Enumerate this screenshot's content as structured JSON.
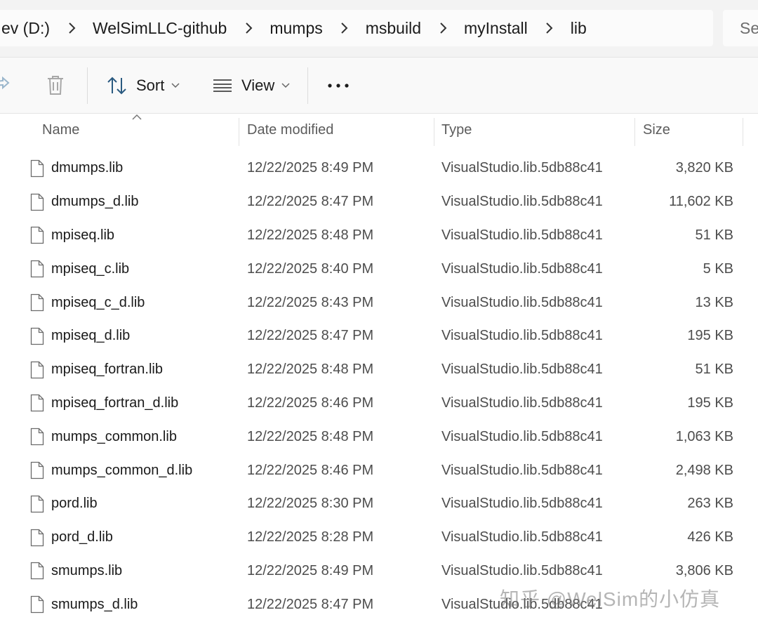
{
  "breadcrumb": {
    "items": [
      "ev (D:)",
      "WelSimLLC-github",
      "mumps",
      "msbuild",
      "myInstall",
      "lib"
    ],
    "separator_icon": "chevron-right-icon"
  },
  "search": {
    "placeholder": "Se"
  },
  "toolbar": {
    "share_icon": "share-icon",
    "delete_icon": "trash-icon",
    "sort_label": "Sort",
    "view_label": "View",
    "more_icon": "more-horizontal-icon"
  },
  "columns": {
    "name": "Name",
    "date_modified": "Date modified",
    "type": "Type",
    "size": "Size"
  },
  "files": [
    {
      "name": "dmumps.lib",
      "date": "12/22/2025 8:49 PM",
      "type": "VisualStudio.lib.5db88c41",
      "size": "3,820 KB"
    },
    {
      "name": "dmumps_d.lib",
      "date": "12/22/2025 8:47 PM",
      "type": "VisualStudio.lib.5db88c41",
      "size": "11,602 KB"
    },
    {
      "name": "mpiseq.lib",
      "date": "12/22/2025 8:48 PM",
      "type": "VisualStudio.lib.5db88c41",
      "size": "51 KB"
    },
    {
      "name": "mpiseq_c.lib",
      "date": "12/22/2025 8:40 PM",
      "type": "VisualStudio.lib.5db88c41",
      "size": "5 KB"
    },
    {
      "name": "mpiseq_c_d.lib",
      "date": "12/22/2025 8:43 PM",
      "type": "VisualStudio.lib.5db88c41",
      "size": "13 KB"
    },
    {
      "name": "mpiseq_d.lib",
      "date": "12/22/2025 8:47 PM",
      "type": "VisualStudio.lib.5db88c41",
      "size": "195 KB"
    },
    {
      "name": "mpiseq_fortran.lib",
      "date": "12/22/2025 8:48 PM",
      "type": "VisualStudio.lib.5db88c41",
      "size": "51 KB"
    },
    {
      "name": "mpiseq_fortran_d.lib",
      "date": "12/22/2025 8:46 PM",
      "type": "VisualStudio.lib.5db88c41",
      "size": "195 KB"
    },
    {
      "name": "mumps_common.lib",
      "date": "12/22/2025 8:48 PM",
      "type": "VisualStudio.lib.5db88c41",
      "size": "1,063 KB"
    },
    {
      "name": "mumps_common_d.lib",
      "date": "12/22/2025 8:46 PM",
      "type": "VisualStudio.lib.5db88c41",
      "size": "2,498 KB"
    },
    {
      "name": "pord.lib",
      "date": "12/22/2025 8:30 PM",
      "type": "VisualStudio.lib.5db88c41",
      "size": "263 KB"
    },
    {
      "name": "pord_d.lib",
      "date": "12/22/2025 8:28 PM",
      "type": "VisualStudio.lib.5db88c41",
      "size": "426 KB"
    },
    {
      "name": "smumps.lib",
      "date": "12/22/2025 8:49 PM",
      "type": "VisualStudio.lib.5db88c41",
      "size": "3,806 KB"
    },
    {
      "name": "smumps_d.lib",
      "date": "12/22/2025 8:47 PM",
      "type": "VisualStudio.lib.5db88c41",
      "size": ""
    }
  ],
  "watermark": "知乎 @WelSim的小仿真",
  "colors": {
    "address_bg": "#f3f3f3",
    "command_bg": "#f9f9f9",
    "text_primary": "#1a1a1a",
    "text_secondary": "#4d4d4d",
    "header_text": "#5c5c5c"
  }
}
